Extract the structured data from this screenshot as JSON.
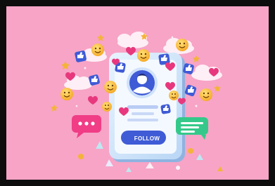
{
  "illustration": {
    "follow_button_label": "FOLLOW",
    "colors": {
      "background": "#f7a4c6",
      "frame": "#0d0d0d",
      "phone_body": "#dcefff",
      "phone_screen": "#f4f9ff",
      "accent_blue": "#3f5bd6",
      "heart_pink": "#e8387d",
      "emoji_yellow": "#ffcc33",
      "chat_bubble_pink": "#f03d86",
      "chat_bubble_green": "#34c98a",
      "cloud_white": "#fff3f8"
    },
    "icons": [
      "smile-emoji-icon",
      "heart-icon",
      "thumbs-up-icon",
      "star-icon",
      "cloud-icon",
      "chat-bubble-icon",
      "user-avatar-icon"
    ]
  }
}
